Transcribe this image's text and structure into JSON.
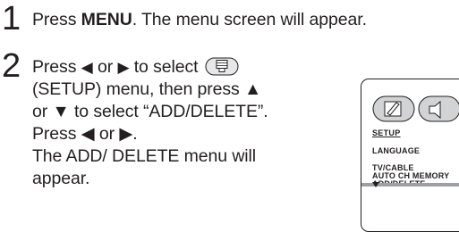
{
  "step1": {
    "number": "1",
    "prefix": "Press ",
    "key": "MENU",
    "suffix": ". The menu screen will appear."
  },
  "step2": {
    "number": "2",
    "line1_press": "Press ",
    "left_arrow": "◀",
    "or": " or ",
    "right_arrow": "▶",
    "line1_select": " to select",
    "setup_icon": "setup-menu-icon",
    "line2": "(SETUP) menu, then press ▲",
    "line3": "or ▼ to select “ADD/DELETE”.",
    "line4": "Press ◀ or ▶.",
    "line5": "The ADD/ DELETE menu will",
    "line6": "appear."
  },
  "osd": {
    "title": "SETUP",
    "items": [
      "LANGUAGE",
      "TV/CABLE",
      "AUTO CH MEMORY",
      "ADD/DELETE"
    ],
    "highlight_color": "#9d9fa2"
  }
}
